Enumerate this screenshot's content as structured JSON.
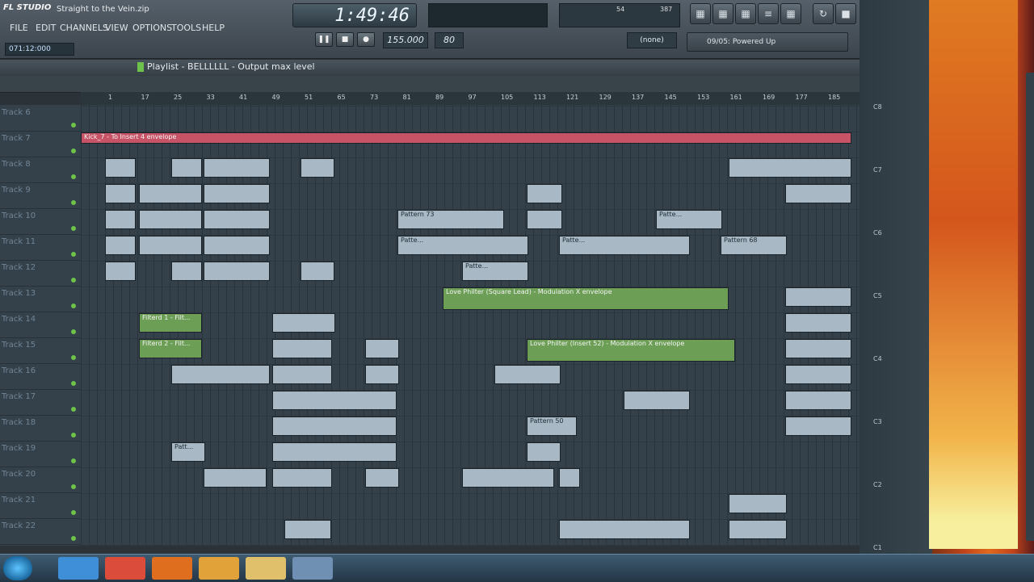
{
  "app": {
    "logo": "FL STUDIO",
    "project": "Straight to the Vein.zip"
  },
  "menu": [
    "FILE",
    "EDIT",
    "CHANNELS",
    "VIEW",
    "OPTIONS",
    "TOOLS",
    "HELP"
  ],
  "time_position": "071:12:000",
  "lcd_time": "1:49:46",
  "tempo": "155.000",
  "pattern_num": "80",
  "mixer_label": "(none)",
  "hint": "09/05: Powered Up",
  "cpu": {
    "v1": "54",
    "v2": "387"
  },
  "playlist_title": "Playlist - BELLLLLL - Output max level",
  "ruler": [
    "1",
    "17",
    "25",
    "33",
    "41",
    "49",
    "51",
    "65",
    "73",
    "81",
    "89",
    "97",
    "105",
    "113",
    "121",
    "129",
    "137",
    "145",
    "153",
    "161",
    "169",
    "177",
    "185"
  ],
  "tracks": [
    "Track 6",
    "Track 7",
    "Track 8",
    "Track 9",
    "Track 10",
    "Track 11",
    "Track 12",
    "Track 13",
    "Track 14",
    "Track 15",
    "Track 16",
    "Track 17",
    "Track 18",
    "Track 19",
    "Track 20",
    "Track 21",
    "Track 22"
  ],
  "clips": {
    "kick": "Kick_7 - To Insert 4 envelope",
    "pattern73": "Pattern 73",
    "patte": "Patte...",
    "pattern68": "Pattern 68",
    "lovephilter1": "Love Philter (Square Lead) - Modulation X envelope",
    "filterd1": "Filterd 1 - Filt...",
    "filterd2": "Filterd 2 - Filt...",
    "lovephilter2": "Love Philter (Insert 52) - Modulation X envelope",
    "pattern50": "Pattern 50",
    "patt": "Patt..."
  },
  "spectro_notes": [
    "C8",
    "C7",
    "C6",
    "C5",
    "C4",
    "C3",
    "C2",
    "C1"
  ],
  "colors": {
    "accent_red": "#c75466",
    "accent_green": "#6c9e55"
  }
}
